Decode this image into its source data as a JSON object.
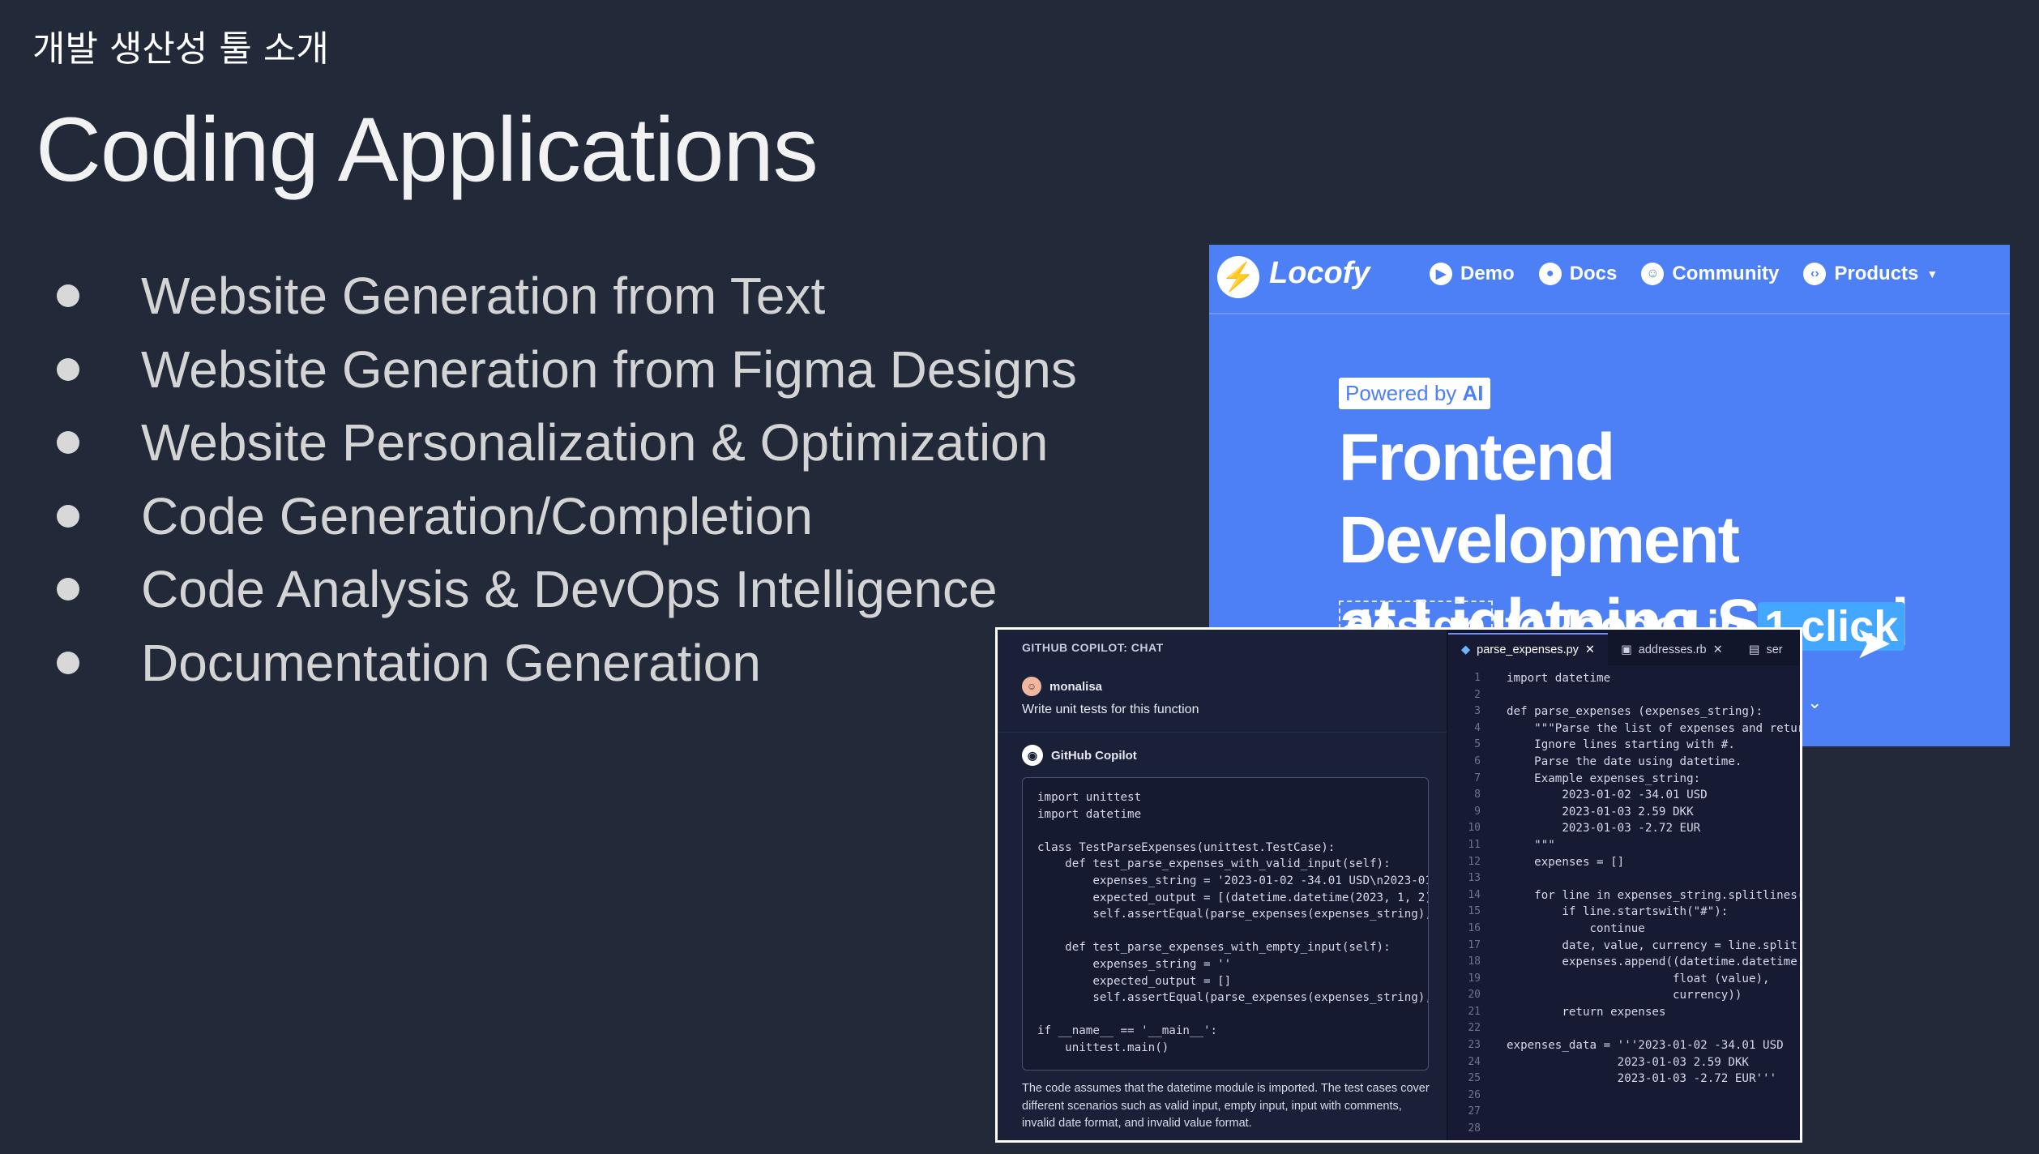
{
  "slide": {
    "subtitle": "개발 생산성 툴 소개",
    "title": "Coding Applications",
    "bullets": [
      "Website Generation from Text",
      "Website Generation from Figma Designs",
      "Website Personalization & Optimization",
      "Code Generation/Completion",
      "Code Analysis & DevOps Intelligence",
      "Documentation Generation"
    ]
  },
  "locofy": {
    "brand": "Locofy",
    "nav": [
      {
        "label": "Demo",
        "icon": "play-icon"
      },
      {
        "label": "Docs",
        "icon": "bulb-icon"
      },
      {
        "label": "Community",
        "icon": "people-icon"
      },
      {
        "label": "Products",
        "icon": "code-icon"
      }
    ],
    "badge_prefix": "Powered by ",
    "badge_strong": "AI",
    "headline_1": "Frontend Development",
    "headline_2": "at Lightning Speed",
    "tag_design": "design",
    "tag_to": " to ",
    "tag_code": "{code}",
    "tag_in": " in ",
    "tag_click": "1 click"
  },
  "copilot": {
    "chat_header": "GITHUB COPILOT: CHAT",
    "user_name": "monalisa",
    "user_message": "Write unit tests for this function",
    "bot_name": "GitHub Copilot",
    "chat_code": "import unittest\nimport datetime\n\nclass TestParseExpenses(unittest.TestCase):\n    def test_parse_expenses_with_valid_input(self):\n        expenses_string = '2023-01-02 -34.01 USD\\n2023-01\n        expected_output = [(datetime.datetime(2023, 1, 2)\n        self.assertEqual(parse_expenses(expenses_string),\n\n    def test_parse_expenses_with_empty_input(self):\n        expenses_string = ''\n        expected_output = []\n        self.assertEqual(parse_expenses(expenses_string),\n\nif __name__ == '__main__':\n    unittest.main()",
    "note": "The code assumes that the datetime module is imported. The test cases cover different scenarios such as valid input, empty input, input with comments, invalid date format, and invalid value format.",
    "tabs": [
      "parse_expenses.py",
      "addresses.rb",
      "ser"
    ],
    "line_numbers": "1\n2\n3\n4\n5\n6\n7\n8\n9\n10\n11\n12\n13\n14\n15\n16\n17\n18\n19\n20\n21\n22\n23\n24\n25\n26\n27\n28",
    "editor_code": "import datetime\n\ndef parse_expenses (expenses_string):\n    \"\"\"Parse the list of expenses and retur\n    Ignore lines starting with #.\n    Parse the date using datetime.\n    Example expenses_string:\n        2023-01-02 -34.01 USD\n        2023-01-03 2.59 DKK\n        2023-01-03 -2.72 EUR\n    \"\"\"\n    expenses = []\n\n    for line in expenses_string.splitlines(\n        if line.startswith(\"#\"):\n            continue\n        date, value, currency = line.split\n        expenses.append((datetime.datetime.\n                        float (value),\n                        currency))\n        return expenses\n\nexpenses_data = '''2023-01-02 -34.01 USD\n                2023-01-03 2.59 DKK\n                2023-01-03 -2.72 EUR'''"
  }
}
